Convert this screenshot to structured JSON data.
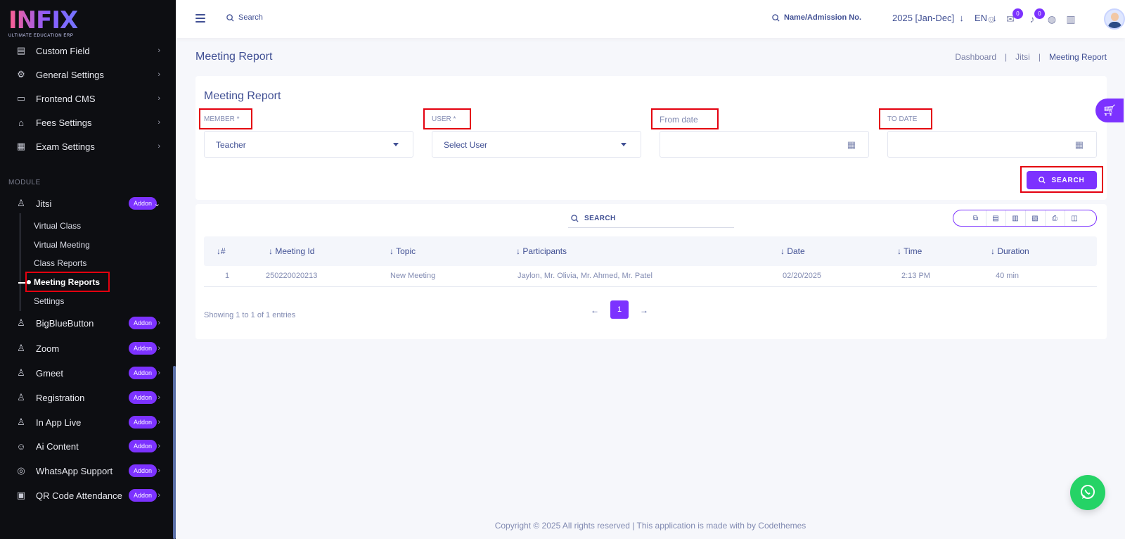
{
  "logo": {
    "word": "INFIX",
    "tag": "ULTIMATE EDUCATION ERP"
  },
  "sidebar": {
    "items": [
      {
        "label": "Custom Field",
        "icon": "id-card-icon"
      },
      {
        "label": "General Settings",
        "icon": "gears-icon"
      },
      {
        "label": "Frontend CMS",
        "icon": "desktop-icon"
      },
      {
        "label": "Fees Settings",
        "icon": "bank-icon"
      },
      {
        "label": "Exam Settings",
        "icon": "clipboard-icon"
      }
    ],
    "module_title": "MODULE",
    "jitsi": {
      "label": "Jitsi",
      "addon": "Addon"
    },
    "jitsi_sub": [
      "Virtual Class",
      "Virtual Meeting",
      "Class Reports",
      "Meeting Reports",
      "Settings"
    ],
    "modules": [
      {
        "label": "BigBlueButton",
        "addon": "Addon"
      },
      {
        "label": "Zoom",
        "addon": "Addon"
      },
      {
        "label": "Gmeet",
        "addon": "Addon"
      },
      {
        "label": "Registration",
        "addon": "Addon"
      },
      {
        "label": "In App Live",
        "addon": "Addon"
      },
      {
        "label": "Ai Content",
        "addon": "Addon"
      },
      {
        "label": "WhatsApp Support",
        "addon": "Addon"
      },
      {
        "label": "QR Code Attendance",
        "addon": "Addon"
      }
    ]
  },
  "header": {
    "search_label": "Search",
    "student_search": "Name/Admission No.",
    "academic_year": "2025 [Jan-Dec]",
    "language": "EN",
    "message_count": "0",
    "notification_count": "0"
  },
  "page": {
    "title": "Meeting Report",
    "breadcrumb": [
      "Dashboard",
      "Jitsi",
      "Meeting Report"
    ]
  },
  "filter": {
    "title": "Meeting Report",
    "member_label": "MEMBER *",
    "member_value": "Teacher",
    "user_label": "USER *",
    "user_value": "Select User",
    "from_label": "From date",
    "to_label": "TO DATE",
    "search_button": "SEARCH"
  },
  "table": {
    "search_label": "SEARCH",
    "columns": [
      "#",
      "Meeting Id",
      "Topic",
      "Participants",
      "Date",
      "Time",
      "Duration"
    ],
    "rows": [
      [
        "1",
        "250220020213",
        "New Meeting",
        "Jaylon, Mr. Olivia, Mr. Ahmed, Mr. Patel",
        "02/20/2025",
        "2:13 PM",
        "40 min"
      ]
    ],
    "entries_text": "Showing 1 to 1 of 1 entries",
    "current_page": "1"
  },
  "footer": "Copyright © 2025 All rights reserved | This application is made with by Codethemes"
}
